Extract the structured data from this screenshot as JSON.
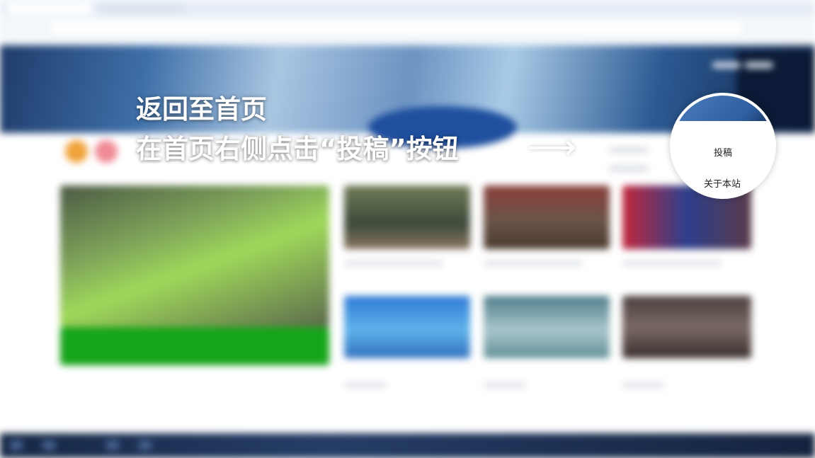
{
  "instruction": {
    "line1": "返回至首页",
    "line2": "在首页右侧点击“投稿”按钮",
    "arrow": "⟶"
  },
  "magnifier": {
    "submit_label": "投稿",
    "about_label": "关于本站"
  },
  "colors": {
    "overlay_text": "#ffffff",
    "banner_blue": "#3f6fa8",
    "featured_green": "#16a51a",
    "taskbar": "#152745"
  }
}
